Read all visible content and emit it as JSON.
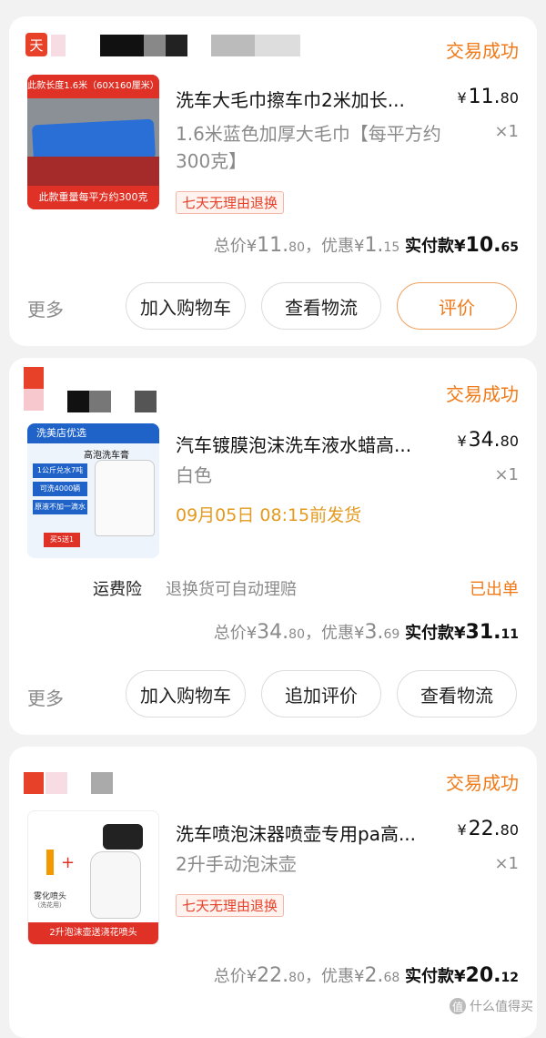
{
  "orders": [
    {
      "status": "交易成功",
      "thumb_text_top": "此款长度1.6米（60X160厘米）",
      "thumb_text_bottom": "此款重量每平方约300克",
      "title": "洗车大毛巾擦车巾2米加长...",
      "price_currency": "¥",
      "price_int": "11.",
      "price_dec": "80",
      "variant": "1.6米蓝色加厚大毛巾【每平方约300克】",
      "qty": "×1",
      "tag": "七天无理由退换",
      "total_label": "总价¥",
      "total_int": "11.",
      "total_dec": "80",
      "discount_label": "，优惠¥",
      "discount_int": "1.",
      "discount_dec": "15",
      "paid_label": "实付款¥",
      "paid_int": "10.",
      "paid_dec": "65",
      "more": "更多",
      "buttons": [
        "加入购物车",
        "查看物流",
        "评价"
      ]
    },
    {
      "status": "交易成功",
      "thumb_banner": "洗美店优选",
      "thumb_product": "高泡洗车膏",
      "thumb_lines": [
        "1公斤兑水7吨",
        "可洗4000辆",
        "原液不加一滴水"
      ],
      "thumb_promo": "买5送1",
      "title": "汽车镀膜泡沫洗车液水蜡高...",
      "price_currency": "¥",
      "price_int": "34.",
      "price_dec": "80",
      "variant": "白色",
      "qty": "×1",
      "ship": "09月05日 08:15前发货",
      "insure_label": "运费险",
      "insure_desc": "退换货可自动理赔",
      "insure_status": "已出单",
      "total_label": "总价¥",
      "total_int": "34.",
      "total_dec": "80",
      "discount_label": "，优惠¥",
      "discount_int": "3.",
      "discount_dec": "69",
      "paid_label": "实付款¥",
      "paid_int": "31.",
      "paid_dec": "11",
      "more": "更多",
      "buttons": [
        "加入购物车",
        "追加评价",
        "查看物流"
      ]
    },
    {
      "status": "交易成功",
      "thumb_label_left": "雾化喷头",
      "thumb_label_left_sub": "（洗花用）",
      "thumb_bottom": "2升泡沫壶送浇花喷头",
      "title": "洗车喷泡沫器喷壶专用pa高...",
      "price_currency": "¥",
      "price_int": "22.",
      "price_dec": "80",
      "variant": "2升手动泡沫壶",
      "qty": "×1",
      "tag": "七天无理由退换",
      "total_label": "总价¥",
      "total_int": "22.",
      "total_dec": "80",
      "discount_label": "，优惠¥",
      "discount_int": "2.",
      "discount_dec": "68",
      "paid_label": "实付款¥",
      "paid_int": "20.",
      "paid_dec": "12"
    }
  ],
  "shop1_badge": "天",
  "watermark": "什么值得买",
  "watermark_icon": "值",
  "colors": {
    "accent": "#f07a18",
    "red": "#e8412a",
    "ship": "#e39a1f"
  }
}
